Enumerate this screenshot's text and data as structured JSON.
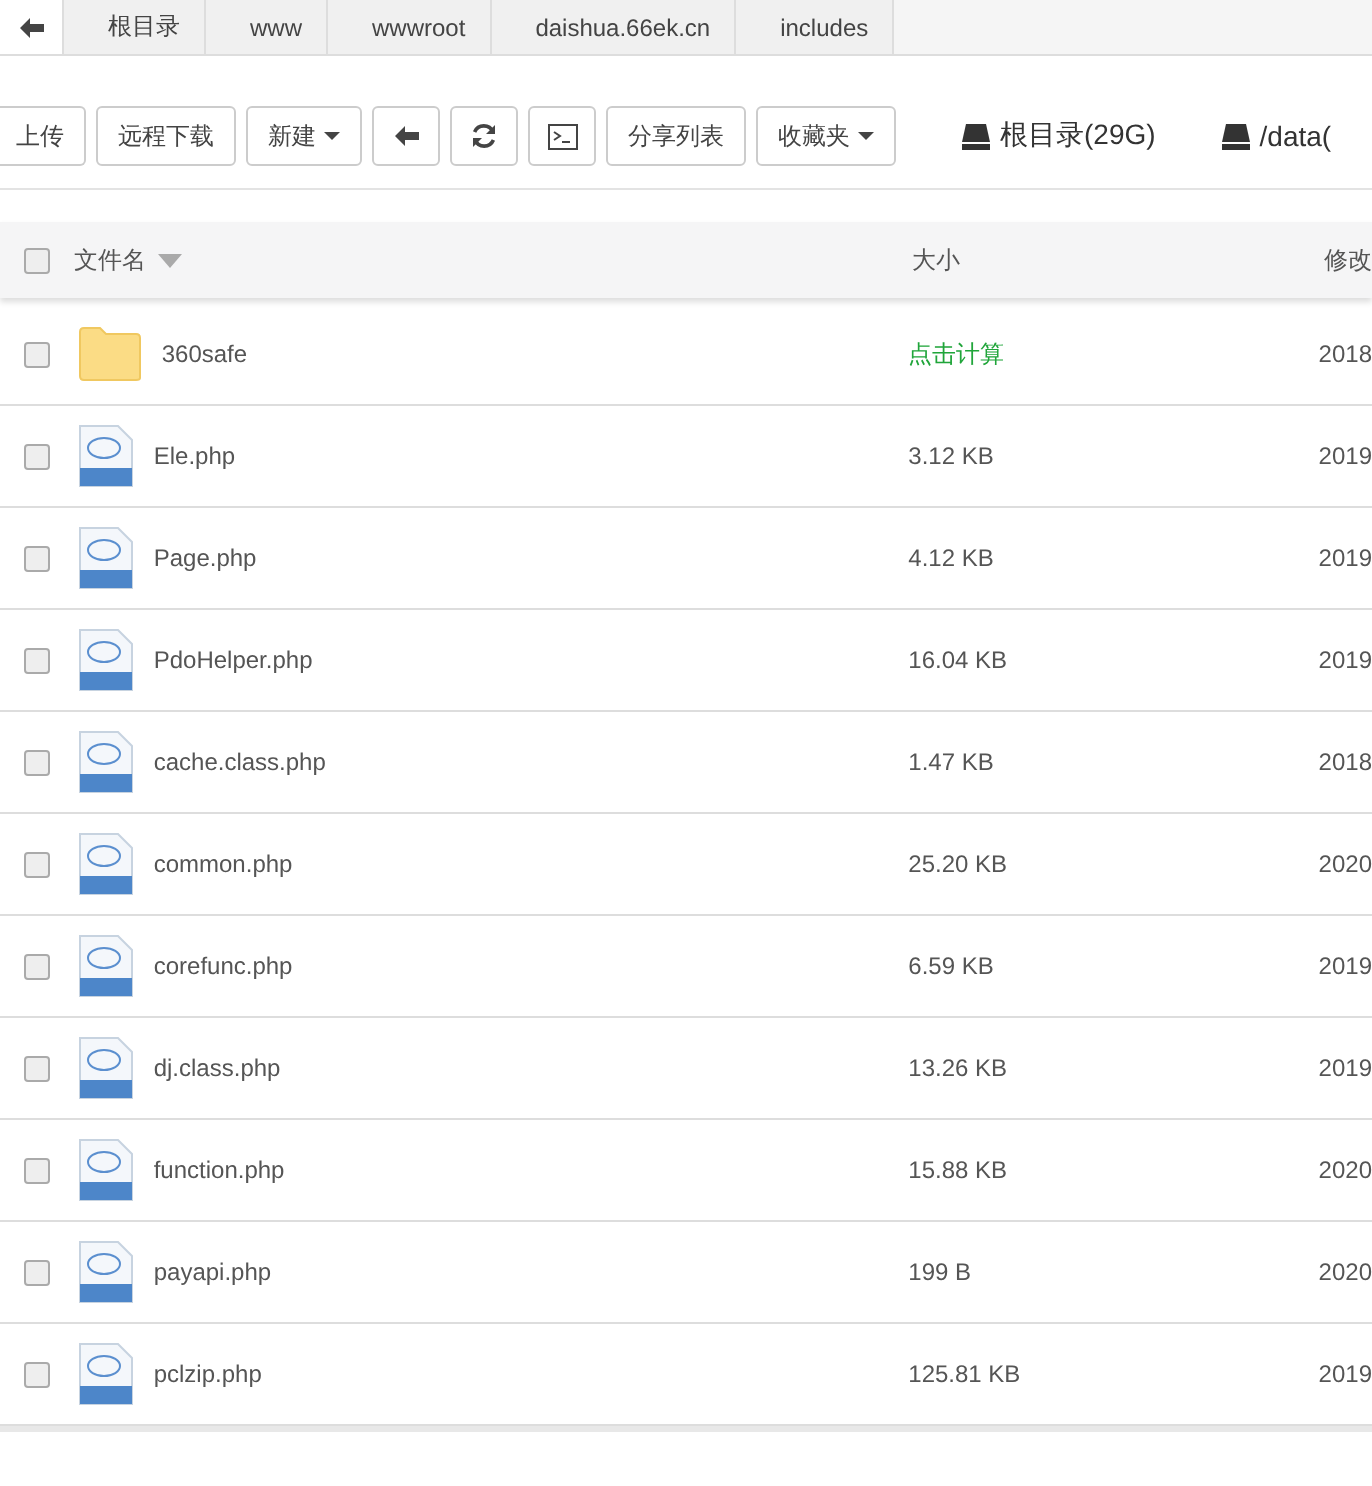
{
  "breadcrumb": [
    "根目录",
    "www",
    "wwwroot",
    "daishua.66ek.cn",
    "includes"
  ],
  "toolbar": [
    {
      "label": "上传",
      "kind": "text"
    },
    {
      "label": "远程下载",
      "kind": "text"
    },
    {
      "label": "新建",
      "kind": "dropdown"
    },
    {
      "kind": "back"
    },
    {
      "kind": "refresh"
    },
    {
      "kind": "terminal"
    },
    {
      "label": "分享列表",
      "kind": "text"
    },
    {
      "label": "收藏夹",
      "kind": "dropdown"
    }
  ],
  "disks": [
    "根目录(29G)",
    "/data("
  ],
  "table": {
    "all_checked": false,
    "columns": [
      "文件名",
      "大小",
      "修改"
    ],
    "rows": [
      {
        "kind": "folder",
        "name": "360safe",
        "size": "点击计算",
        "size_is_link": true,
        "date": "2018",
        "checked": false
      },
      {
        "kind": "php",
        "name": "Ele.php",
        "size": "3.12 KB",
        "size_is_link": false,
        "date": "2019",
        "checked": false
      },
      {
        "kind": "php",
        "name": "Page.php",
        "size": "4.12 KB",
        "size_is_link": false,
        "date": "2019",
        "checked": false
      },
      {
        "kind": "php",
        "name": "PdoHelper.php",
        "size": "16.04 KB",
        "size_is_link": false,
        "date": "2019",
        "checked": false
      },
      {
        "kind": "php",
        "name": "cache.class.php",
        "size": "1.47 KB",
        "size_is_link": false,
        "date": "2018",
        "checked": false
      },
      {
        "kind": "php",
        "name": "common.php",
        "size": "25.20 KB",
        "size_is_link": false,
        "date": "2020",
        "checked": false
      },
      {
        "kind": "php",
        "name": "corefunc.php",
        "size": "6.59 KB",
        "size_is_link": false,
        "date": "2019",
        "checked": false
      },
      {
        "kind": "php",
        "name": "dj.class.php",
        "size": "13.26 KB",
        "size_is_link": false,
        "date": "2019",
        "checked": false
      },
      {
        "kind": "php",
        "name": "function.php",
        "size": "15.88 KB",
        "size_is_link": false,
        "date": "2020",
        "checked": false
      },
      {
        "kind": "php",
        "name": "payapi.php",
        "size": "199 B",
        "size_is_link": false,
        "date": "2020",
        "checked": false
      },
      {
        "kind": "php",
        "name": "pclzip.php",
        "size": "125.81 KB",
        "size_is_link": false,
        "date": "2019",
        "checked": false
      }
    ]
  }
}
